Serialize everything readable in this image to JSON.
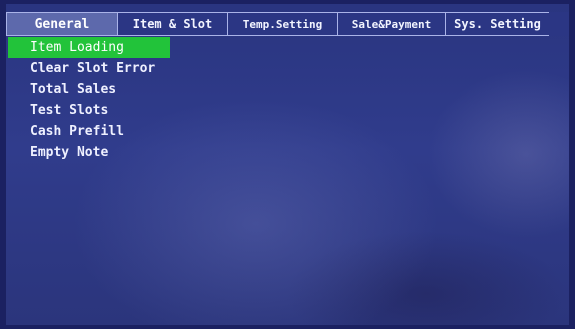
{
  "tabs": [
    {
      "label": "General",
      "active": true
    },
    {
      "label": "Item & Slot",
      "active": false
    },
    {
      "label": "Temp.Setting",
      "active": false
    },
    {
      "label": "Sale&Payment",
      "active": false
    },
    {
      "label": "Sys. Setting",
      "active": false
    }
  ],
  "menu": {
    "items": [
      {
        "label": "Item Loading",
        "selected": true
      },
      {
        "label": "Clear Slot Error",
        "selected": false
      },
      {
        "label": "Total Sales",
        "selected": false
      },
      {
        "label": "Test Slots",
        "selected": false
      },
      {
        "label": "Cash Prefill",
        "selected": false
      },
      {
        "label": "Empty Note",
        "selected": false
      }
    ]
  },
  "colors": {
    "screen_background": "#303c8c",
    "selection_highlight": "#22c33a",
    "active_tab": "#5d69ac"
  }
}
